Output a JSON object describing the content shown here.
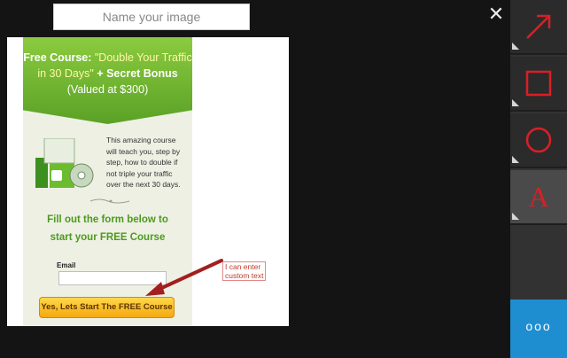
{
  "name_field": {
    "placeholder": "Name your image",
    "value": ""
  },
  "close_label": "✕",
  "image": {
    "banner": {
      "line1_prefix": "Free Course:",
      "line1_quote": "\"Double Your Traffic",
      "line2_quote": "in 30 Days\"",
      "line2_suffix": "+ Secret Bonus",
      "line3": "(Valued at $300)"
    },
    "course_description": "This amazing course will teach you, step by step, how to double if not triple your traffic over the next 30 days.",
    "form_heading_line1": "Fill out the form below to",
    "form_heading_line2": "start your FREE Course",
    "email_label": "Email",
    "cta_label": "Yes, Lets Start The FREE Course"
  },
  "annotation": {
    "text_line1": "I can enter",
    "text_line2": "custom text"
  },
  "tools": [
    {
      "name": "arrow-tool",
      "icon": "arrow-icon"
    },
    {
      "name": "rectangle-tool",
      "icon": "square-icon"
    },
    {
      "name": "ellipse-tool",
      "icon": "circle-icon"
    },
    {
      "name": "text-tool",
      "icon": "text-icon",
      "label": "A"
    }
  ],
  "more_label": "ooo",
  "colors": {
    "tool_icon": "#d91f26",
    "more_bg": "#1f8ed1",
    "banner_green": "#6fb52f"
  }
}
